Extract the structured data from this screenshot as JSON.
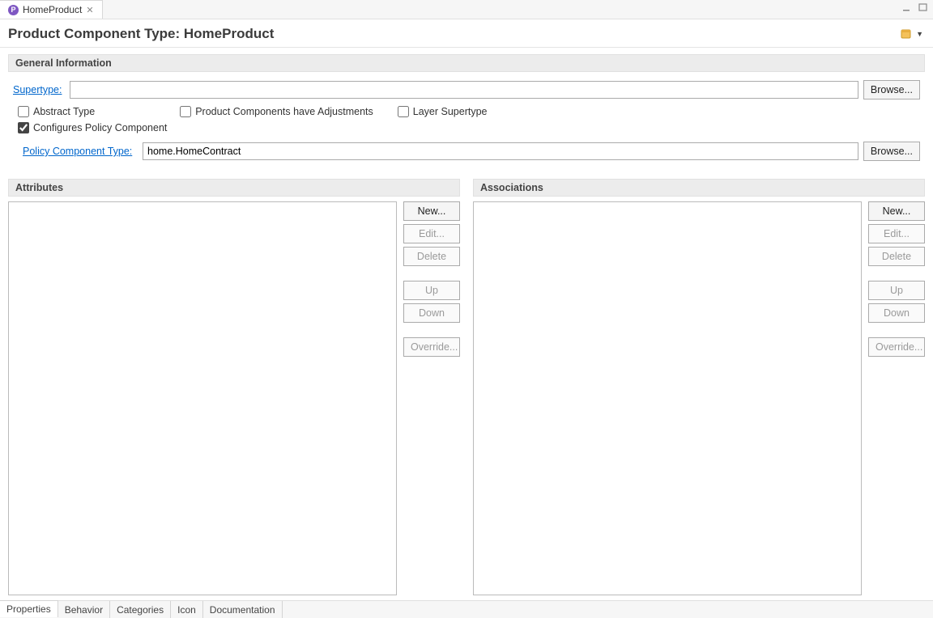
{
  "tab": {
    "title": "HomeProduct"
  },
  "header": {
    "title": "Product Component Type: HomeProduct"
  },
  "general": {
    "section_title": "General Information",
    "supertype_label": "Supertype:",
    "supertype_value": "",
    "browse": "Browse...",
    "abstract_label": "Abstract Type",
    "abstract_checked": false,
    "adjustments_label": "Product Components have Adjustments",
    "adjustments_checked": false,
    "layer_label": "Layer Supertype",
    "layer_checked": false,
    "configures_label": "Configures Policy Component",
    "configures_checked": true,
    "policy_label": "Policy Component Type:",
    "policy_value": "home.HomeContract",
    "browse2": "Browse..."
  },
  "attributes": {
    "section_title": "Attributes",
    "buttons": {
      "new": "New...",
      "edit": "Edit...",
      "delete": "Delete",
      "up": "Up",
      "down": "Down",
      "override": "Override..."
    }
  },
  "associations": {
    "section_title": "Associations",
    "buttons": {
      "new": "New...",
      "edit": "Edit...",
      "delete": "Delete",
      "up": "Up",
      "down": "Down",
      "override": "Override..."
    }
  },
  "bottom_tabs": [
    "Properties",
    "Behavior",
    "Categories",
    "Icon",
    "Documentation"
  ],
  "active_bottom_tab": "Properties"
}
